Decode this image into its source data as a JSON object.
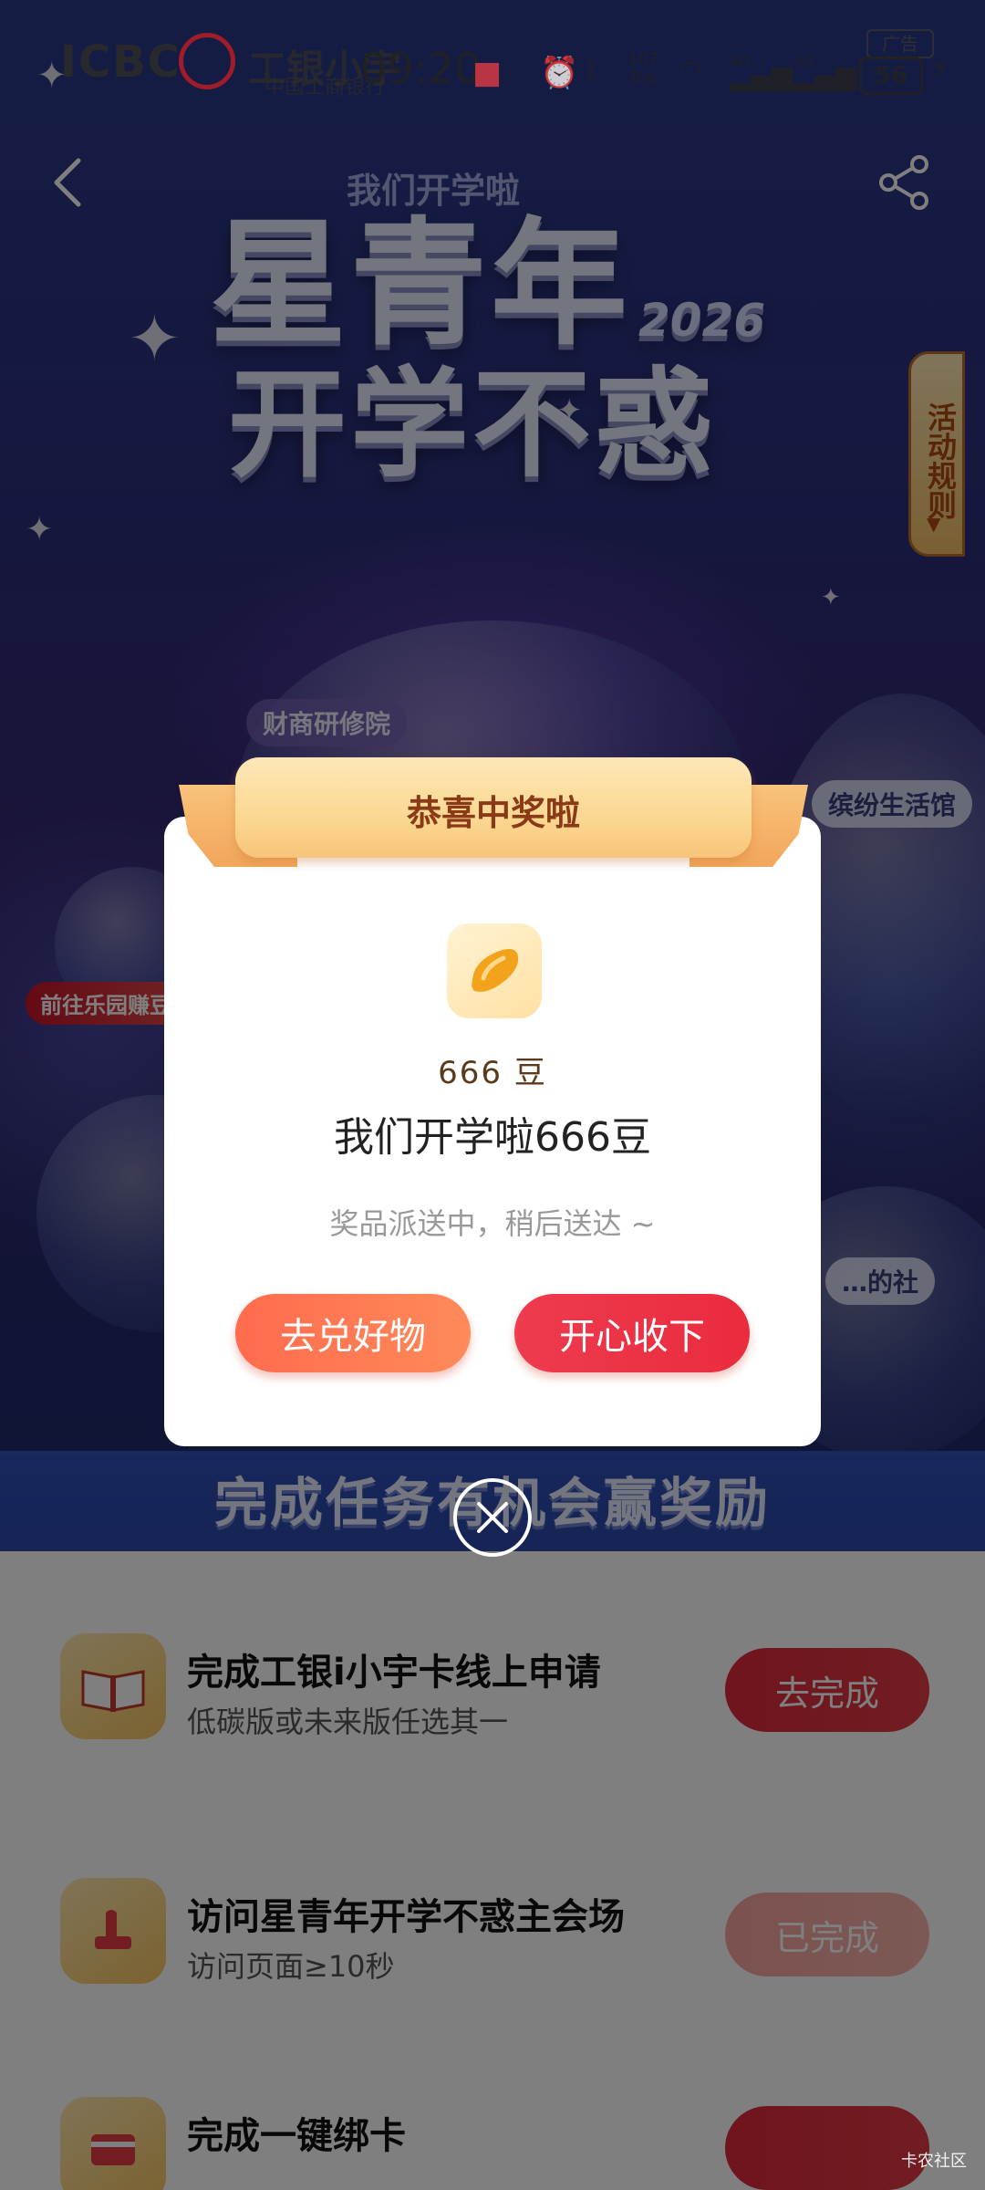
{
  "status_bar": {
    "brand_en": "ICBC",
    "brand_cn": "工银小宇",
    "brand_bank_cn": "中国工商银行",
    "time": "09:20",
    "net_speed_value": "107",
    "net_speed_unit": "B/s",
    "network_1": "4G",
    "network_2": "4G",
    "battery": "56",
    "ad_label": "广告"
  },
  "hero": {
    "subtitle": "我们开学啦",
    "title_line1": "星青年",
    "title_line2": "开学不惑",
    "year": "2026",
    "rules_tab": "活动规则",
    "label_finance": "财商研修院",
    "label_life": "缤纷生活馆",
    "label_park": "前往乐园赚豆",
    "label_club": "…的社"
  },
  "task_section": {
    "banner_title": "完成任务有机会赢奖励",
    "tasks": [
      {
        "title": "完成工银i小宇卡线上申请",
        "desc": "低碳版或未来版任选其一",
        "button": "去完成",
        "status": "todo"
      },
      {
        "title": "访问星青年开学不惑主会场",
        "desc": "访问页面≥10秒",
        "button": "已完成",
        "status": "done"
      },
      {
        "title": "完成一键绑卡",
        "desc": "",
        "button": "",
        "status": "todo"
      }
    ]
  },
  "dialog": {
    "ribbon_title": "恭喜中奖啦",
    "prize_amount": "666 豆",
    "prize_name": "我们开学啦666豆",
    "hint": "奖品派送中，稍后送达 ~",
    "btn_exchange": "去兑好物",
    "btn_accept": "开心收下"
  },
  "watermark": "卡农社区",
  "colors": {
    "accent_red": "#E23B45",
    "accent_orange": "#FF7A55",
    "ribbon_gold": "#F9C37B",
    "banner_blue": "#2D4AA9"
  }
}
